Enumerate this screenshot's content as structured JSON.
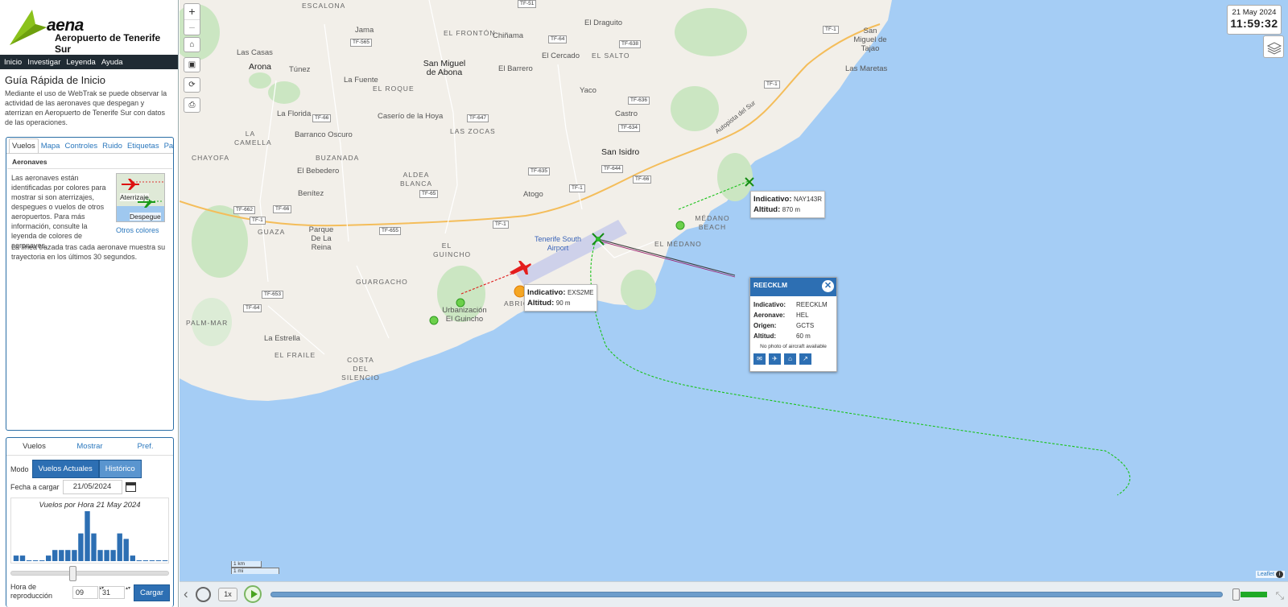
{
  "brand": {
    "logo": "aena",
    "airport": "Aeropuerto de Tenerife Sur"
  },
  "menu": [
    "Inicio",
    "Investigar",
    "Leyenda",
    "Ayuda"
  ],
  "guide": {
    "title": "Guía Rápida de Inicio",
    "text": "Mediante el uso de WebTrak se puede observar la actividad de las aeronaves que despegan y aterrizan en Aeropuerto de Tenerife Sur con datos de las operaciones."
  },
  "info_tabs": [
    "Vuelos",
    "Mapa",
    "Controles",
    "Ruido",
    "Etiquetas",
    "Paneles"
  ],
  "aeronaves": {
    "heading": "Aeronaves",
    "text": "Las aeronaves están identificadas por colores para mostrar si son aterrizajes, despegues o vuelos de otros aeropuertos. Para más información, consulte la leyenda de colores de aeronaves.",
    "img_label_arrival": "Aterrizaje",
    "img_label_departure": "Despegue",
    "other_colors": "Otros colores",
    "trail_text": "La línea trazada tras cada aeronave muestra su trayectoria en los últimos 30 segundos."
  },
  "controls": {
    "tabs": [
      "Vuelos",
      "Mostrar",
      "Pref."
    ],
    "mode_label": "Modo",
    "mode_current": "Vuelos Actuales",
    "mode_history": "Histórico",
    "date_label": "Fecha a cargar",
    "date_value": "21/05/2024",
    "histogram_title": "Vuelos por Hora 21 May 2024",
    "histogram": [
      1,
      1,
      0,
      0,
      0,
      1,
      2,
      2,
      2,
      2,
      5,
      9,
      5,
      2,
      2,
      2,
      5,
      4,
      1,
      0,
      0,
      0,
      0,
      0
    ],
    "time_label": "Hora de reproducción",
    "hour": "09",
    "minute": "31",
    "load_button": "Cargar"
  },
  "map": {
    "zoom_in": "+",
    "zoom_out": "−",
    "clock_date": "21 May 2024",
    "clock_time": "11:59:32",
    "places": {
      "escalona": "ESCALONA",
      "jama": "Jama",
      "frontón": "EL FRONTÓN",
      "chiñama": "Chiñama",
      "dragutio": "El Draguito",
      "san_miguel_tajao": "San Miguel de Tajao",
      "arona": "Arona",
      "las_casas": "Las Casas",
      "tunez": "Túnez",
      "san_miguel_abona": "San Miguel de Abona",
      "el_cercado": "El Cercado",
      "el_salto": "EL SALTO",
      "las_maretas": "Las Maretas",
      "la_fuente": "La Fuente",
      "el_roque": "EL ROQUE",
      "el_barrero": "El Barrero",
      "yaco": "Yaco",
      "la_florida": "La Florida",
      "caserio_hoya": "Caserío de la Hoya",
      "castro": "Castro",
      "autopista": "Autopista del Sur",
      "la_camella": "LA CAMELLA",
      "barranco_oscuro": "Barranco Oscuro",
      "las_zocas": "LAS ZOCAS",
      "chayofa": "CHAYOFA",
      "buzanada": "BUZANADA",
      "san_isidro": "San Isidro",
      "el_bebedero": "El Bebedero",
      "aldea_blanca": "ALDEA BLANCA",
      "benitez": "Benítez",
      "atogo": "Atogo",
      "guaza": "GUAZA",
      "parque_reina": "Parque De La Reina",
      "medano_beach": "MÉDANO BEACH",
      "el_guincho": "EL GUINCHO",
      "tenerife_south": "Tenerife South Airport",
      "el_medano": "EL MÉDANO",
      "guargacho": "GUARGACHO",
      "urbanizacion": "Urbanización El Guincho",
      "abrigo": "ABRIG",
      "palm_mar": "PALM-MAR",
      "la_estrella": "La Estrella",
      "el_fraile": "EL FRAILE",
      "costa_silencio": "COSTA DEL SILENCIO"
    },
    "roads": [
      "TF-51",
      "TF-565",
      "TF-64",
      "TF-638",
      "TF-1",
      "TF-1",
      "TF-636",
      "TF-647",
      "TF-66",
      "TF-634",
      "TF-635",
      "TF-644",
      "TF-66",
      "TF-65",
      "TF-662",
      "TF-66",
      "TF-1",
      "TF-1",
      "TF-1",
      "TF-655",
      "TF-653",
      "TF-64"
    ],
    "label_nay": {
      "k1": "Indicativo:",
      "v1": "NAY143R",
      "k2": "Altitud:",
      "v2": "870 m"
    },
    "label_exs": {
      "k1": "Indicativo:",
      "v1": "EXS2ME",
      "k2": "Altitud:",
      "v2": "90 m"
    },
    "popup": {
      "title": "REECKLM",
      "rows": [
        {
          "k": "Indicativo:",
          "v": "REECKLM"
        },
        {
          "k": "Aeronave:",
          "v": "HEL"
        },
        {
          "k": "Origen:",
          "v": "GCTS"
        },
        {
          "k": "Altitud:",
          "v": "60 m"
        }
      ],
      "no_photo": "No photo of aircraft available"
    },
    "scale_km": "1 km",
    "scale_mi": "1 mi",
    "attribution": "Leaflet"
  },
  "playback": {
    "speed": "1x"
  }
}
